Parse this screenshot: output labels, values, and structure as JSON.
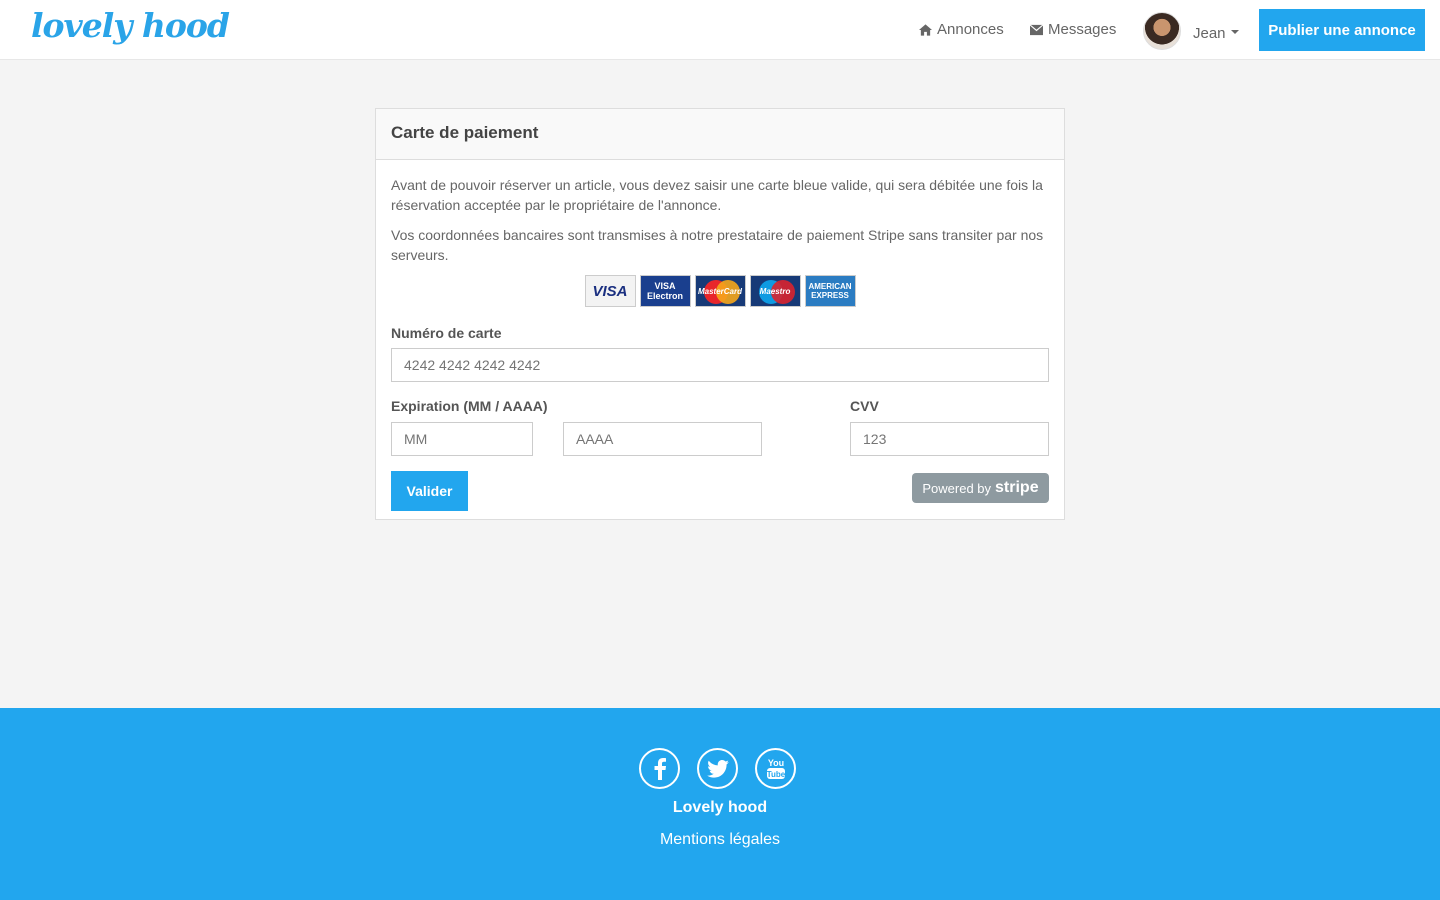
{
  "brand": {
    "logo_text": "lovely hood",
    "accent": "#22a6ee"
  },
  "nav": {
    "annonces": {
      "label": "Annonces",
      "icon": "home-icon"
    },
    "messages": {
      "label": "Messages",
      "icon": "envelope-icon"
    },
    "user": {
      "name": "Jean"
    },
    "publish_label": "Publier une annonce"
  },
  "payment": {
    "title": "Carte de paiement",
    "para1": "Avant de pouvoir réserver un article, vous devez saisir une carte bleue valide, qui sera débitée une fois la réservation acceptée par le propriétaire de l'annonce.",
    "para2": "Vos coordonnées bancaires sont transmises à notre prestataire de paiement Stripe sans transiter par nos serveurs.",
    "cards": {
      "visa": "VISA",
      "electron_top": "VISA",
      "electron_bottom": "Electron",
      "mastercard": "MasterCard",
      "maestro": "Maestro",
      "amex_top": "AMERICAN",
      "amex_bottom": "EXPRESS"
    },
    "card_number_label": "Numéro de carte",
    "card_number_placeholder": "4242 4242 4242 4242",
    "expiration_label": "Expiration (MM / AAAA)",
    "mm_placeholder": "MM",
    "aaaa_placeholder": "AAAA",
    "cvv_label": "CVV",
    "cvv_placeholder": "123",
    "validate_label": "Valider",
    "stripe_powered": "Powered by",
    "stripe_name": "stripe"
  },
  "footer": {
    "socials": [
      "facebook-icon",
      "twitter-icon",
      "youtube-icon"
    ],
    "brand": "Lovely hood",
    "legal_link": "Mentions légales"
  }
}
